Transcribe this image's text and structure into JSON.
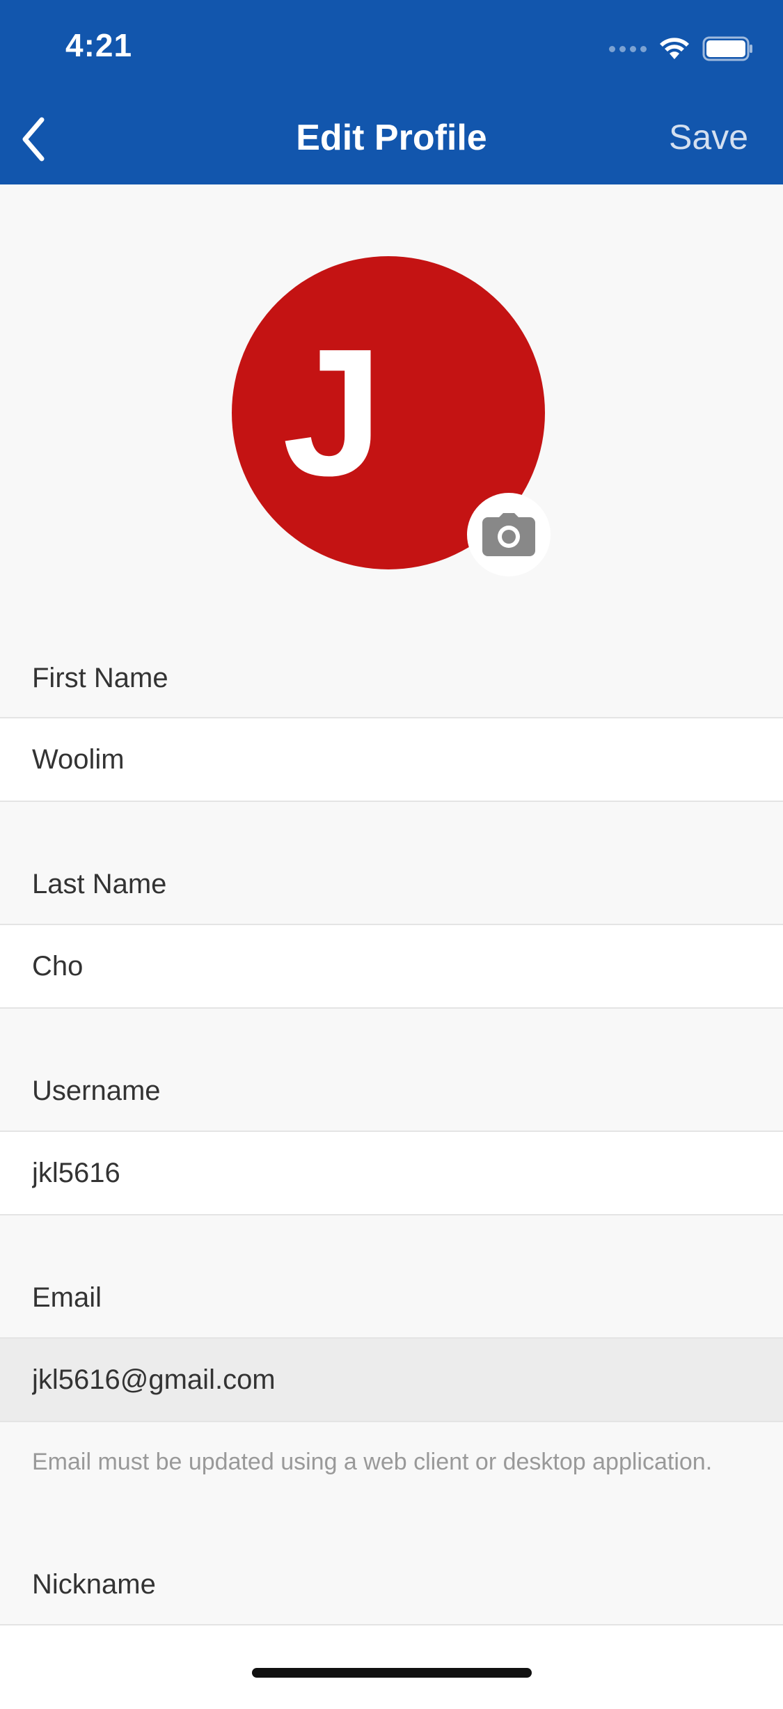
{
  "status_bar": {
    "time": "4:21"
  },
  "nav": {
    "title": "Edit Profile",
    "save_label": "Save"
  },
  "avatar": {
    "initial": "J",
    "color": "#c41313"
  },
  "fields": {
    "first_name": {
      "label": "First Name",
      "value": "Woolim"
    },
    "last_name": {
      "label": "Last Name",
      "value": "Cho"
    },
    "username": {
      "label": "Username",
      "value": "jkl5616"
    },
    "email": {
      "label": "Email",
      "value": "jkl5616@gmail.com",
      "help": "Email must be updated using a web client or desktop application."
    },
    "nickname": {
      "label": "Nickname",
      "value": ""
    }
  },
  "colors": {
    "header": "#1256ad",
    "background": "#f8f8f8"
  }
}
